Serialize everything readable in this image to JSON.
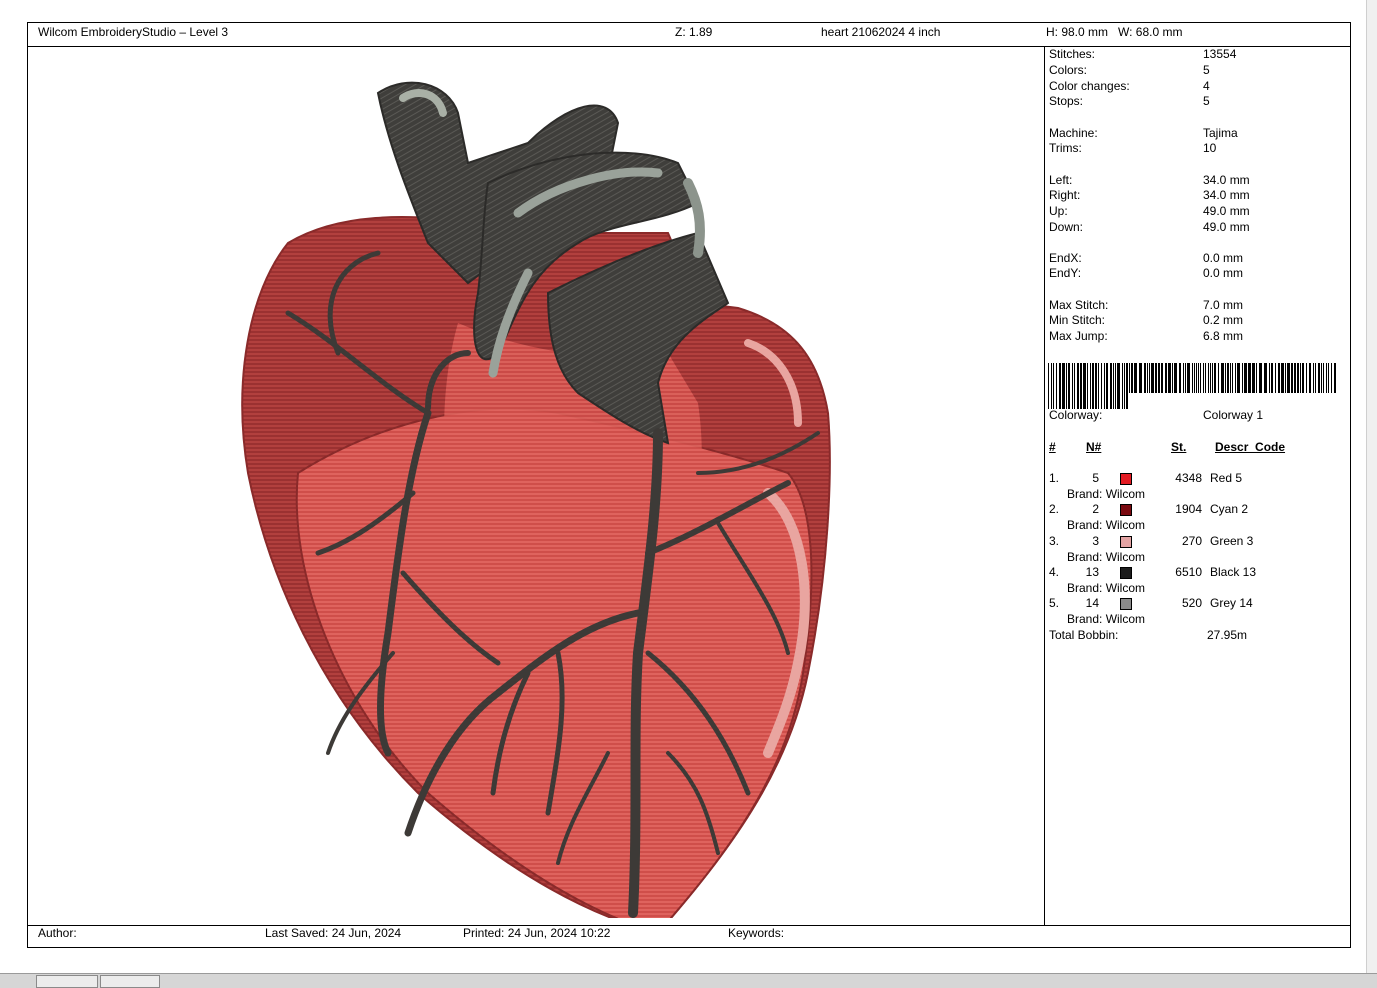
{
  "header": {
    "app_title": "Wilcom EmbroideryStudio – Level 3",
    "zoom": "Z: 1.89",
    "design_name": "heart 21062024 4 inch",
    "size": "H: 98.0 mm   W: 68.0 mm"
  },
  "stats": [
    {
      "label": "Stitches:",
      "value": "13554"
    },
    {
      "label": "Colors:",
      "value": "5"
    },
    {
      "label": "Color changes:",
      "value": "4"
    },
    {
      "label": "Stops:",
      "value": "5"
    },
    {
      "label": "Machine:",
      "value": "Tajima"
    },
    {
      "label": "Trims:",
      "value": "10"
    },
    {
      "label": "Left:",
      "value": "34.0 mm"
    },
    {
      "label": "Right:",
      "value": "34.0 mm"
    },
    {
      "label": "Up:",
      "value": "49.0 mm"
    },
    {
      "label": "Down:",
      "value": "49.0 mm"
    },
    {
      "label": "EndX:",
      "value": "0.0 mm"
    },
    {
      "label": "EndY:",
      "value": "0.0 mm"
    },
    {
      "label": "Max Stitch:",
      "value": "7.0 mm"
    },
    {
      "label": "Min Stitch:",
      "value": "0.2 mm"
    },
    {
      "label": "Max Jump:",
      "value": "6.8 mm"
    }
  ],
  "colorway": {
    "label": "Colorway:",
    "value": "Colorway 1"
  },
  "table": {
    "headers": {
      "num": "#",
      "n": "N#",
      "st": "St.",
      "descr": "Descr  Code"
    },
    "rows": [
      {
        "num": "1.",
        "n": "5",
        "color": "#e31b23",
        "st": "4348",
        "descr": "Red 5",
        "brand": "Brand: Wilcom"
      },
      {
        "num": "2.",
        "n": "2",
        "color": "#7a0a10",
        "st": "1904",
        "descr": "Cyan 2",
        "brand": "Brand: Wilcom"
      },
      {
        "num": "3.",
        "n": "3",
        "color": "#e3a3a3",
        "st": "270",
        "descr": "Green 3",
        "brand": "Brand: Wilcom"
      },
      {
        "num": "4.",
        "n": "13",
        "color": "#1c1c1c",
        "st": "6510",
        "descr": "Black 13",
        "brand": "Brand: Wilcom"
      },
      {
        "num": "5.",
        "n": "14",
        "color": "#8a8a8a",
        "st": "520",
        "descr": "Grey 14",
        "brand": "Brand: Wilcom"
      }
    ],
    "total_label": "Total Bobbin:",
    "total_value": "27.95m"
  },
  "footer": {
    "author": "Author:",
    "last_saved": "Last Saved: 24 Jun, 2024",
    "printed": "Printed: 24 Jun, 2024 10:22",
    "keywords": "Keywords:"
  },
  "colors": {
    "heart_light": "#e25a55",
    "heart_dark": "#a92f2f",
    "vessel": "#3f3b38",
    "aorta": "#4a4a47",
    "highlight": "#9aa29a"
  }
}
